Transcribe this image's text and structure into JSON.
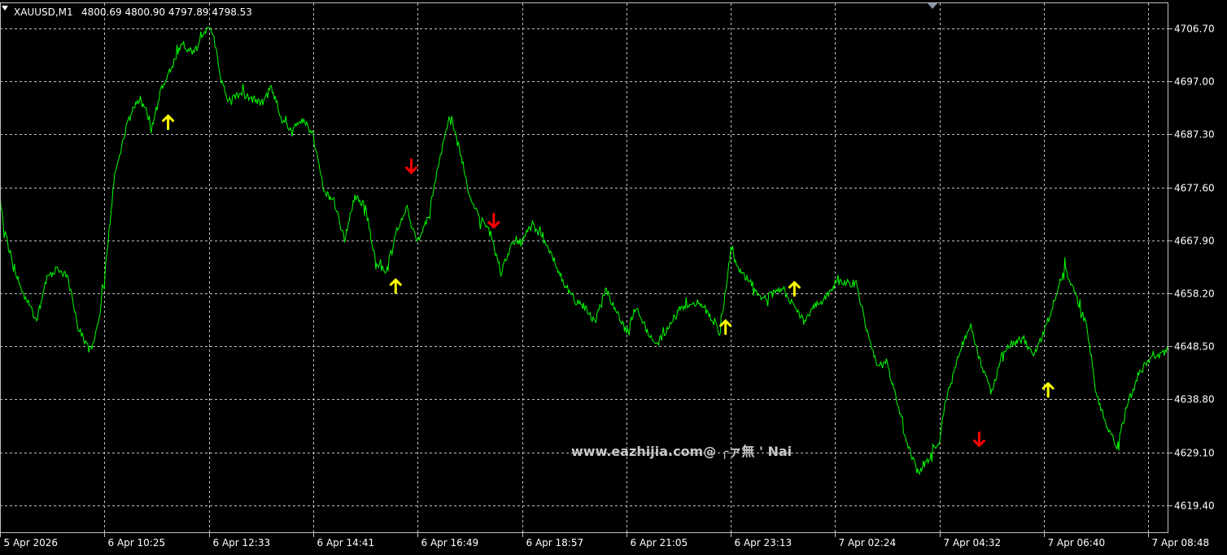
{
  "header": {
    "symbol": "XAUUSD,M1",
    "ohlc": "4800.69 4800.90 4797.89 4798.53"
  },
  "watermark": "www.eazhijia.com@ ╭ァ無 ' Nai",
  "colors": {
    "background": "#000000",
    "grid": "#c0c0c0",
    "frame": "#c0c0c0",
    "line": "#00ff00",
    "up_arrow": "#ffff00",
    "down_arrow": "#ff0000",
    "text": "#ffffff"
  },
  "chart_data": {
    "type": "line",
    "title": "XAUUSD,M1",
    "xlabel": "",
    "ylabel": "",
    "grid": true,
    "ylim": [
      4614.0,
      4711.5
    ],
    "y_ticks": [
      "4706.70",
      "4697.00",
      "4687.30",
      "4677.60",
      "4667.90",
      "4658.20",
      "4648.50",
      "4638.80",
      "4629.10",
      "4619.40"
    ],
    "x_ticks": [
      "5 Apr 2026",
      "6 Apr 10:25",
      "6 Apr 12:33",
      "6 Apr 14:41",
      "6 Apr 16:49",
      "6 Apr 18:57",
      "6 Apr 21:05",
      "6 Apr 23:13",
      "7 Apr 02:24",
      "7 Apr 04:32",
      "7 Apr 06:40",
      "7 Apr 08:48"
    ],
    "series": [
      {
        "x_index": [
          0,
          0.05,
          0.12,
          0.2,
          0.28,
          0.35,
          0.45,
          0.55,
          0.65,
          0.75,
          0.82,
          0.88,
          0.95,
          1.0,
          1.1,
          1.2,
          1.3,
          1.38,
          1.45,
          1.55,
          1.65,
          1.75,
          1.85,
          1.95,
          2.0,
          2.06,
          2.12,
          2.2,
          2.3,
          2.4,
          2.5,
          2.6,
          2.7,
          2.8,
          2.9,
          3.0,
          3.1,
          3.2,
          3.3,
          3.4,
          3.5,
          3.6,
          3.7,
          3.8,
          3.9,
          3.95,
          4.0,
          4.1,
          4.2,
          4.3,
          4.4,
          4.5,
          4.6,
          4.7,
          4.8,
          4.9,
          5.0,
          5.1,
          5.2,
          5.3,
          5.4,
          5.5,
          5.6,
          5.7,
          5.8,
          5.9,
          6.0,
          6.1,
          6.2,
          6.3,
          6.4,
          6.5,
          6.6,
          6.7,
          6.8,
          6.9,
          7.0,
          7.1,
          7.2,
          7.3,
          7.4,
          7.5,
          7.6,
          7.7,
          7.8,
          7.9,
          8.0,
          8.1,
          8.2,
          8.3,
          8.4,
          8.5,
          8.6,
          8.7,
          8.8,
          8.9,
          9.0,
          9.05,
          9.1,
          9.2,
          9.3,
          9.4,
          9.5,
          9.6,
          9.7,
          9.8,
          9.9,
          10.0,
          10.1,
          10.2,
          10.3,
          10.4,
          10.5,
          10.6,
          10.7,
          10.8,
          10.9,
          11.0,
          11.2
        ],
        "values": [
          4676,
          4669,
          4664,
          4659,
          4656,
          4653,
          4661,
          4663,
          4661,
          4652,
          4649,
          4648,
          4653,
          4661,
          4680,
          4688,
          4693,
          4693,
          4688,
          4696,
          4700,
          4704,
          4702,
          4705,
          4708,
          4704,
          4697,
          4693,
          4695,
          4694,
          4693,
          4696,
          4690,
          4688,
          4690,
          4687,
          4677,
          4675,
          4668,
          4676,
          4674,
          4664,
          4662,
          4670,
          4674,
          4670,
          4668,
          4672,
          4682,
          4690,
          4685,
          4676,
          4672,
          4669,
          4662,
          4667,
          4668,
          4671,
          4668,
          4665,
          4660,
          4657,
          4656,
          4653,
          4659,
          4655,
          4651,
          4656,
          4651,
          4649,
          4652,
          4655,
          4656,
          4657,
          4654,
          4651,
          4666,
          4662,
          4660,
          4657,
          4658,
          4659,
          4656,
          4653,
          4656,
          4657,
          4660,
          4660,
          4660,
          4652,
          4645,
          4645,
          4638,
          4630,
          4625,
          4628,
          4631,
          4638,
          4641,
          4648,
          4652,
          4645,
          4640,
          4647,
          4649,
          4650,
          4647,
          4651,
          4657,
          4663,
          4658,
          4653,
          4640,
          4634,
          4630,
          4638,
          4643,
          4646,
          4648
        ]
      }
    ],
    "buy_signals": [
      {
        "x_index": 1.61,
        "value": 4689.5
      },
      {
        "x_index": 3.79,
        "value": 4659.5
      },
      {
        "x_index": 6.95,
        "value": 4652.0
      },
      {
        "x_index": 7.61,
        "value": 4659.0
      },
      {
        "x_index": 10.04,
        "value": 4640.5
      }
    ],
    "sell_signals": [
      {
        "x_index": 3.94,
        "value": 4681.5
      },
      {
        "x_index": 4.73,
        "value": 4671.5
      },
      {
        "x_index": 9.38,
        "value": 4631.5
      }
    ]
  }
}
